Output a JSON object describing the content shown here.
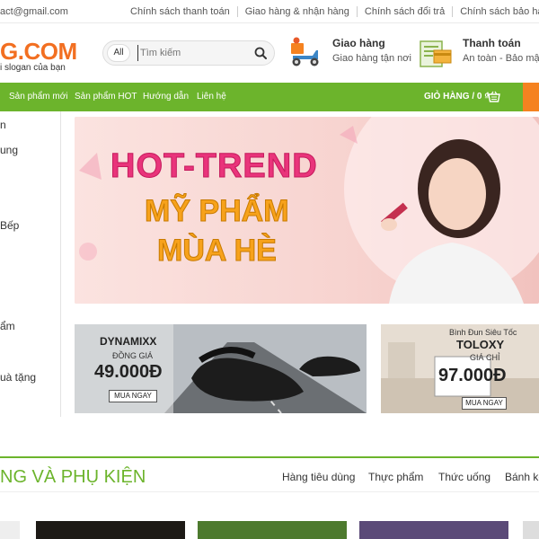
{
  "topbar": {
    "email": "act@gmail.com",
    "links": [
      "Chính sách thanh toán",
      "Giao hàng & nhận hàng",
      "Chính sách đổi trả",
      "Chính sách bảo hành"
    ]
  },
  "header": {
    "logo_text": "G.COM",
    "slogan": "i slogan của bạn",
    "search": {
      "category": "All",
      "placeholder": "Tìm kiếm"
    },
    "features": [
      {
        "title": "Giao hàng",
        "subtitle": "Giao hàng tận nơi",
        "icon": "delivery-scooter-icon"
      },
      {
        "title": "Thanh toán",
        "subtitle": "An toàn - Bảo mật",
        "icon": "payment-card-icon"
      }
    ]
  },
  "nav": {
    "items": [
      "Sản phẩm mới",
      "Sản phẩm HOT",
      "Hướng dẫn",
      "Liên hệ"
    ],
    "cart_label": "GIỎ HÀNG / 0 ₫"
  },
  "sidebar": {
    "items": [
      "n",
      "ung",
      "Bếp",
      "ẩm",
      "uà tặng"
    ]
  },
  "banner": {
    "line1": "HOT-TREND",
    "line2": "MỸ PHẨM",
    "line3": "MÙA HÈ"
  },
  "promos": [
    {
      "brand": "DYNAMIXX",
      "label": "ĐỒNG GIÁ",
      "price": "49.000Đ",
      "button": "MUA NGAY"
    },
    {
      "subtitle": "Bình Đun Siêu Tốc",
      "brand": "TOLOXY",
      "label": "GIÁ CHỈ",
      "price": "97.000Đ",
      "button": "MUA NGAY"
    }
  ],
  "section": {
    "title": "NG VÀ PHỤ KIỆN",
    "tabs": [
      "Hàng tiêu dùng",
      "Thực phẩm",
      "Thức uống",
      "Bánh kẹo"
    ]
  },
  "colors": {
    "brand_green": "#6cb42c",
    "accent_orange": "#f58220",
    "logo_orange": "#f26f21"
  }
}
